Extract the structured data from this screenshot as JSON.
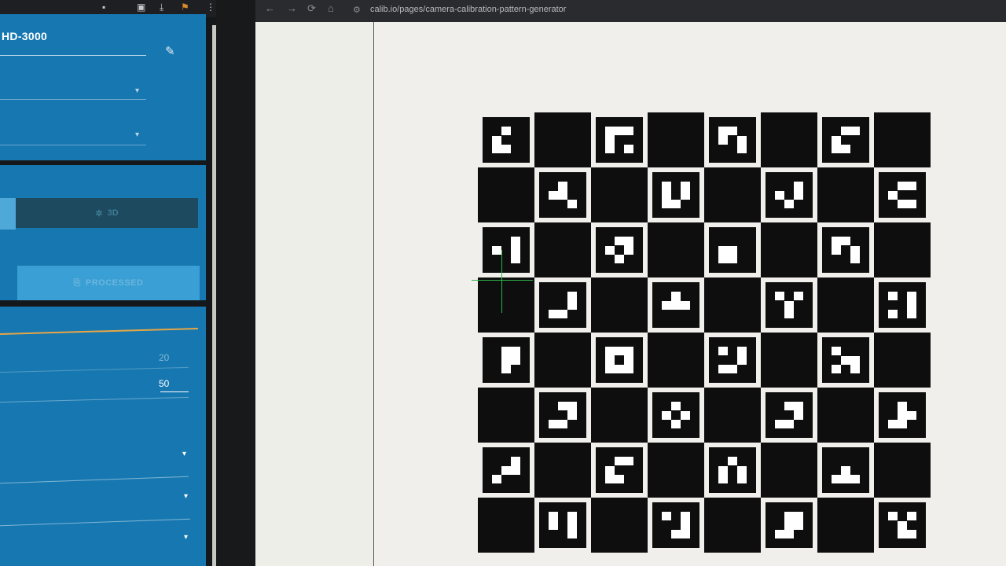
{
  "left_panel": {
    "toolbar_icons": [
      "extension-icon",
      "download-icon",
      "notification-icon",
      "menu-icon"
    ],
    "camera_select": {
      "value": "HD-3000"
    },
    "button_3d": {
      "label": "3D",
      "icon": "gear-icon"
    },
    "button_processed": {
      "label": "PROCESSED",
      "icon": "export-icon"
    },
    "field_values": {
      "value_1": "20",
      "value_2": "50"
    }
  },
  "browser": {
    "url": "calib.io/pages/camera-calibration-pattern-generator",
    "nav": {
      "back": "←",
      "forward": "→",
      "reload": "⟳",
      "home": "⌂"
    }
  },
  "pattern": {
    "type": "ChArUco board",
    "rows": 8,
    "cols": 8,
    "markers": [
      {
        "r": 0,
        "c": 0,
        "bits": [
          [
            0,
            0
          ],
          [
            2,
            0
          ],
          [
            1,
            1
          ],
          [
            2,
            1
          ],
          [
            2,
            2
          ]
        ]
      },
      {
        "r": 0,
        "c": 2,
        "bits": [
          [
            1,
            1
          ],
          [
            2,
            1
          ],
          [
            1,
            2
          ]
        ]
      },
      {
        "r": 0,
        "c": 4,
        "bits": [
          [
            2,
            0
          ],
          [
            1,
            1
          ],
          [
            0,
            2
          ],
          [
            1,
            2
          ]
        ]
      },
      {
        "r": 0,
        "c": 6,
        "bits": [
          [
            0,
            0
          ],
          [
            1,
            1
          ],
          [
            2,
            1
          ],
          [
            2,
            2
          ]
        ]
      },
      {
        "r": 1,
        "c": 1,
        "bits": [
          [
            0,
            0
          ],
          [
            2,
            0
          ],
          [
            2,
            1
          ],
          [
            0,
            2
          ],
          [
            1,
            2
          ]
        ]
      },
      {
        "r": 1,
        "c": 3,
        "bits": [
          [
            1,
            0
          ],
          [
            1,
            1
          ],
          [
            2,
            2
          ]
        ]
      },
      {
        "r": 1,
        "c": 5,
        "bits": [
          [
            0,
            0
          ],
          [
            1,
            0
          ],
          [
            1,
            1
          ],
          [
            0,
            2
          ],
          [
            2,
            2
          ]
        ]
      },
      {
        "r": 1,
        "c": 7,
        "bits": [
          [
            0,
            0
          ],
          [
            1,
            1
          ],
          [
            2,
            1
          ],
          [
            0,
            2
          ]
        ]
      },
      {
        "r": 2,
        "c": 0,
        "bits": [
          [
            0,
            0
          ],
          [
            1,
            0
          ],
          [
            1,
            1
          ],
          [
            0,
            2
          ],
          [
            1,
            2
          ]
        ]
      },
      {
        "r": 2,
        "c": 2,
        "bits": [
          [
            0,
            0
          ],
          [
            1,
            1
          ],
          [
            0,
            2
          ],
          [
            2,
            2
          ]
        ]
      },
      {
        "r": 2,
        "c": 4,
        "bits": [
          [
            0,
            0
          ],
          [
            1,
            0
          ],
          [
            2,
            0
          ],
          [
            2,
            1
          ],
          [
            2,
            2
          ]
        ]
      },
      {
        "r": 2,
        "c": 6,
        "bits": [
          [
            2,
            0
          ],
          [
            1,
            1
          ],
          [
            0,
            2
          ],
          [
            1,
            2
          ]
        ]
      },
      {
        "r": 3,
        "c": 1,
        "bits": [
          [
            0,
            0
          ],
          [
            1,
            0
          ],
          [
            0,
            1
          ],
          [
            1,
            1
          ],
          [
            2,
            2
          ]
        ]
      },
      {
        "r": 3,
        "c": 3,
        "bits": [
          [
            0,
            0
          ],
          [
            2,
            0
          ],
          [
            0,
            2
          ],
          [
            1,
            2
          ],
          [
            2,
            2
          ]
        ]
      },
      {
        "r": 3,
        "c": 5,
        "bits": [
          [
            1,
            0
          ],
          [
            0,
            1
          ],
          [
            2,
            1
          ],
          [
            0,
            2
          ],
          [
            2,
            2
          ]
        ]
      },
      {
        "r": 3,
        "c": 7,
        "bits": [
          [
            1,
            0
          ],
          [
            0,
            1
          ],
          [
            1,
            1
          ],
          [
            1,
            2
          ]
        ]
      },
      {
        "r": 4,
        "c": 0,
        "bits": [
          [
            0,
            0
          ],
          [
            0,
            1
          ],
          [
            0,
            2
          ],
          [
            2,
            2
          ]
        ]
      },
      {
        "r": 4,
        "c": 2,
        "bits": [
          [
            1,
            1
          ]
        ]
      },
      {
        "r": 4,
        "c": 4,
        "bits": [
          [
            1,
            0
          ],
          [
            0,
            1
          ],
          [
            1,
            1
          ],
          [
            2,
            2
          ]
        ]
      },
      {
        "r": 4,
        "c": 6,
        "bits": [
          [
            1,
            0
          ],
          [
            2,
            0
          ],
          [
            0,
            1
          ],
          [
            1,
            2
          ]
        ]
      },
      {
        "r": 5,
        "c": 1,
        "bits": [
          [
            0,
            0
          ],
          [
            0,
            1
          ],
          [
            1,
            1
          ],
          [
            2,
            2
          ]
        ]
      },
      {
        "r": 5,
        "c": 3,
        "bits": [
          [
            0,
            0
          ],
          [
            2,
            0
          ],
          [
            1,
            1
          ],
          [
            0,
            2
          ],
          [
            2,
            2
          ]
        ]
      },
      {
        "r": 5,
        "c": 5,
        "bits": [
          [
            0,
            0
          ],
          [
            0,
            1
          ],
          [
            1,
            1
          ],
          [
            2,
            2
          ]
        ]
      },
      {
        "r": 5,
        "c": 7,
        "bits": [
          [
            0,
            0
          ],
          [
            2,
            0
          ],
          [
            0,
            1
          ],
          [
            2,
            2
          ]
        ]
      },
      {
        "r": 6,
        "c": 0,
        "bits": [
          [
            0,
            0
          ],
          [
            1,
            0
          ],
          [
            0,
            1
          ],
          [
            1,
            2
          ],
          [
            2,
            2
          ]
        ]
      },
      {
        "r": 6,
        "c": 2,
        "bits": [
          [
            0,
            0
          ],
          [
            1,
            1
          ],
          [
            2,
            1
          ],
          [
            2,
            2
          ]
        ]
      },
      {
        "r": 6,
        "c": 4,
        "bits": [
          [
            0,
            0
          ],
          [
            2,
            0
          ],
          [
            1,
            1
          ],
          [
            1,
            2
          ]
        ]
      },
      {
        "r": 6,
        "c": 6,
        "bits": [
          [
            0,
            0
          ],
          [
            1,
            0
          ],
          [
            2,
            0
          ],
          [
            0,
            1
          ],
          [
            2,
            1
          ]
        ]
      },
      {
        "r": 7,
        "c": 1,
        "bits": [
          [
            1,
            0
          ],
          [
            1,
            1
          ],
          [
            0,
            2
          ],
          [
            1,
            2
          ]
        ]
      },
      {
        "r": 7,
        "c": 3,
        "bits": [
          [
            1,
            0
          ],
          [
            0,
            1
          ],
          [
            1,
            1
          ],
          [
            0,
            2
          ]
        ]
      },
      {
        "r": 7,
        "c": 5,
        "bits": [
          [
            0,
            0
          ],
          [
            0,
            1
          ],
          [
            2,
            2
          ]
        ]
      },
      {
        "r": 7,
        "c": 7,
        "bits": [
          [
            1,
            0
          ],
          [
            0,
            1
          ],
          [
            2,
            1
          ],
          [
            0,
            2
          ]
        ]
      }
    ]
  },
  "colors": {
    "panel_blue": "#1778b1",
    "accent_orange": "#e6a646",
    "crosshair_green": "#2db64a"
  }
}
